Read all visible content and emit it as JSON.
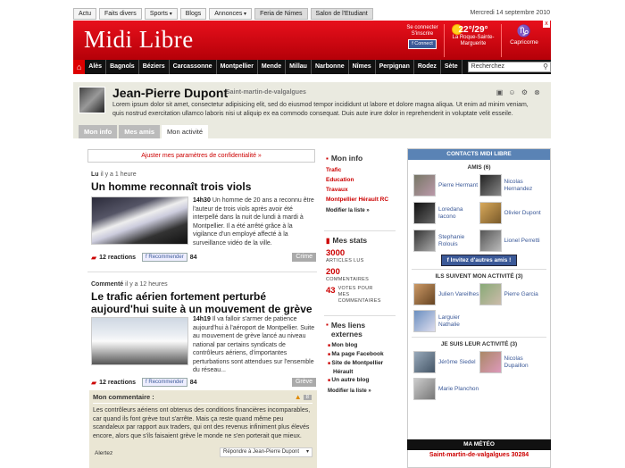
{
  "topnav": {
    "items": [
      "Actu",
      "Faits divers",
      "Sports",
      "Blogs",
      "Annonces",
      "Feria de Nimes",
      "Salon de l'Etudiant"
    ],
    "date": "Mercredi 14 septembre 2010"
  },
  "header": {
    "logo": "Midi Libre",
    "connect_line1": "Se connecter",
    "connect_line2": "S'inscrire",
    "fb_connect": "Connect",
    "temps": "22°/29°",
    "weather_city": "La Roque-Sainte-Marguerite",
    "horoscope": "Capricorne",
    "close": "x"
  },
  "citynav": {
    "cities": [
      "Alès",
      "Bagnols",
      "Béziers",
      "Carcassonne",
      "Montpellier",
      "Mende",
      "Millau",
      "Narbonne",
      "Nîmes",
      "Perpignan",
      "Rodez",
      "Sète"
    ],
    "search_placeholder": "Recherchez"
  },
  "profile": {
    "name": "Jean-Pierre Dupont",
    "location": "Saint-martin-de-valgalgues",
    "bio": "Lorem ipsum dolor sit amet, consectetur adipisicing elit, sed do eiusmod tempor incididunt ut labore et dolore magna aliqua. Ut enim ad minim veniam, quis nostrud exercitation ullamco laboris nisi ut aliquip ex ea commodo consequat. Duis aute irure dolor in reprehenderit in voluptate velit esseile.",
    "tabs": [
      "Mon info",
      "Mes amis",
      "Mon activité"
    ]
  },
  "main": {
    "privacy_link": "Ajuster mes paramètres de confidentialité »",
    "articles": [
      {
        "meta_action": "Lu",
        "meta_time": "il y a 1 heure",
        "title": "Un homme reconnaît trois viols",
        "time": "14h30",
        "text": "Un homme de 20 ans a reconnu être l'auteur de trois viols après avoir été interpellé dans la nuit de lundi à mardi à Montpellier. Il a été arrêté grâce à la vigilance d'un employé affecté à la surveillance vidéo de la ville.",
        "reactions": "12 reactions",
        "recommend": "Recommender",
        "rec_count": "84",
        "tag": "Crime"
      },
      {
        "meta_action": "Commenté",
        "meta_time": "il y a 12 heures",
        "title": "Le trafic aérien fortement perturbé aujourd'hui suite à un mouvement de grève",
        "time": "14h19",
        "text": "Il va falloir s'armer de patience aujourd'hui à l'aéroport de Montpellier. Suite au mouvement de grève lancé au niveau national par certains syndicats de contrôleurs aériens, d'importantes perturbations sont attendues sur l'ensemble du réseau...",
        "reactions": "12 reactions",
        "recommend": "Recommender",
        "rec_count": "84",
        "tag": "Grève"
      }
    ],
    "comment": {
      "heading": "Mon commentaire :",
      "likes": "8",
      "text": "Les contrôleurs aériens ont obtenus des conditions financières incomparables, car quand ils font grève tout s'arrête. Mais ça reste quand même peu scandaleux par rapport aux traders, qui ont des revenus infiniment plus élevés encore, alors que s'ils faisaient grève le monde ne s'en porterait que mieux.",
      "alert": "Alertez",
      "reply": "Répondre à Jean-Pierre Dupont"
    }
  },
  "mid": {
    "info_title": "Mon info",
    "info_links": [
      "Trafic",
      "Education",
      "Travaux",
      "Montpellier Hérault RC"
    ],
    "modify": "Modifier la liste »",
    "stats_title": "Mes stats",
    "stats": [
      {
        "num": "3000",
        "label": "ARTICLES LUS"
      },
      {
        "num": "200",
        "label": "COMMENTAIRES"
      },
      {
        "num": "43",
        "label": "VOTES POUR MES COMMENTAIRES"
      }
    ],
    "links_title": "Mes liens externes",
    "links": [
      "Mon blog",
      "Ma page Facebook",
      "Site de Montpellier Hérault",
      "Un autre blog"
    ]
  },
  "right": {
    "contacts_title": "CONTACTS MIDI LIBRE",
    "friends_title": "AMIS (6)",
    "friends": [
      "Pierre Hermant",
      "Nicolas Hernandez",
      "Loredana Iacono",
      "Olivier Dupont",
      "Stephanie Rolouis",
      "Lionel Perretti"
    ],
    "invite": "Invitez d'autres amis !",
    "followers_title": "ILS SUIVENT MON ACTIVITÉ (3)",
    "followers": [
      "Julien Vareilhes",
      "Pierre Garcia",
      "Larguier Nathalie"
    ],
    "following_title": "JE SUIS LEUR ACTIVITÉ (3)",
    "following": [
      "Jérôme Siedel",
      "Nicolas Dupaillon",
      "Marie Planchon"
    ],
    "meteo_title": "MA MÉTÉO",
    "meteo_city": "Saint-martin-de-valgalgues 30284"
  }
}
